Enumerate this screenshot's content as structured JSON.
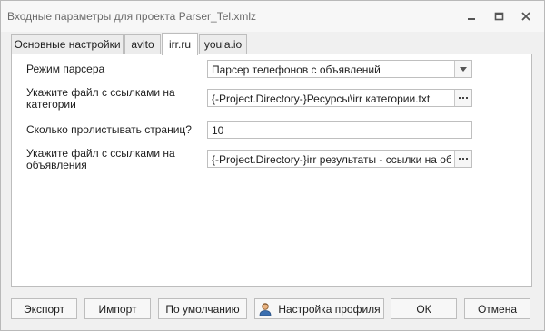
{
  "window": {
    "title": "Входные параметры для проекта Parser_Tel.xmlz",
    "controls": {
      "minimize_icon": "minimize-icon",
      "maximize_icon": "maximize-icon",
      "close_icon": "close-icon"
    }
  },
  "tabs": [
    {
      "label": "Основные настройки",
      "active": false
    },
    {
      "label": "avito",
      "active": false
    },
    {
      "label": "irr.ru",
      "active": true
    },
    {
      "label": "youla.io",
      "active": false
    }
  ],
  "form": {
    "parser_mode": {
      "label": "Режим парсера",
      "value": "Парсер телефонов с объявлений",
      "icon": "chevron-down-icon"
    },
    "category_file": {
      "label": "Укажите файл с ссылками на категории",
      "value": "{-Project.Directory-}Ресурсы\\irr категории.txt",
      "icon": "ellipsis-icon"
    },
    "pages_count": {
      "label": "Сколько пролистывать страниц?",
      "value": "10"
    },
    "ads_file": {
      "label": "Укажите файл с ссылками на объявления",
      "value": "{-Project.Directory-}irr результаты - ссылки на объяв...",
      "icon": "ellipsis-icon"
    }
  },
  "footer": {
    "export": "Экспорт",
    "import": "Импорт",
    "default": "По умолчанию",
    "profile": "Настройка профиля",
    "profile_icon": "user-profile-icon",
    "ok": "ОК",
    "cancel": "Отмена"
  },
  "colors": {
    "window_bg": "#f0f0f0",
    "border": "#bdbdbd",
    "title_text": "#6b6b6b"
  }
}
